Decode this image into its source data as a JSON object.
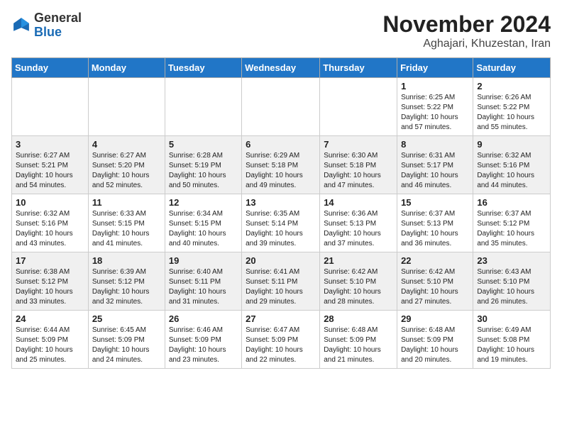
{
  "header": {
    "logo_general": "General",
    "logo_blue": "Blue",
    "title": "November 2024",
    "subtitle": "Aghajari, Khuzestan, Iran"
  },
  "calendar": {
    "days_of_week": [
      "Sunday",
      "Monday",
      "Tuesday",
      "Wednesday",
      "Thursday",
      "Friday",
      "Saturday"
    ],
    "weeks": [
      [
        {
          "day": "",
          "info": ""
        },
        {
          "day": "",
          "info": ""
        },
        {
          "day": "",
          "info": ""
        },
        {
          "day": "",
          "info": ""
        },
        {
          "day": "",
          "info": ""
        },
        {
          "day": "1",
          "info": "Sunrise: 6:25 AM\nSunset: 5:22 PM\nDaylight: 10 hours\nand 57 minutes."
        },
        {
          "day": "2",
          "info": "Sunrise: 6:26 AM\nSunset: 5:22 PM\nDaylight: 10 hours\nand 55 minutes."
        }
      ],
      [
        {
          "day": "3",
          "info": "Sunrise: 6:27 AM\nSunset: 5:21 PM\nDaylight: 10 hours\nand 54 minutes."
        },
        {
          "day": "4",
          "info": "Sunrise: 6:27 AM\nSunset: 5:20 PM\nDaylight: 10 hours\nand 52 minutes."
        },
        {
          "day": "5",
          "info": "Sunrise: 6:28 AM\nSunset: 5:19 PM\nDaylight: 10 hours\nand 50 minutes."
        },
        {
          "day": "6",
          "info": "Sunrise: 6:29 AM\nSunset: 5:18 PM\nDaylight: 10 hours\nand 49 minutes."
        },
        {
          "day": "7",
          "info": "Sunrise: 6:30 AM\nSunset: 5:18 PM\nDaylight: 10 hours\nand 47 minutes."
        },
        {
          "day": "8",
          "info": "Sunrise: 6:31 AM\nSunset: 5:17 PM\nDaylight: 10 hours\nand 46 minutes."
        },
        {
          "day": "9",
          "info": "Sunrise: 6:32 AM\nSunset: 5:16 PM\nDaylight: 10 hours\nand 44 minutes."
        }
      ],
      [
        {
          "day": "10",
          "info": "Sunrise: 6:32 AM\nSunset: 5:16 PM\nDaylight: 10 hours\nand 43 minutes."
        },
        {
          "day": "11",
          "info": "Sunrise: 6:33 AM\nSunset: 5:15 PM\nDaylight: 10 hours\nand 41 minutes."
        },
        {
          "day": "12",
          "info": "Sunrise: 6:34 AM\nSunset: 5:15 PM\nDaylight: 10 hours\nand 40 minutes."
        },
        {
          "day": "13",
          "info": "Sunrise: 6:35 AM\nSunset: 5:14 PM\nDaylight: 10 hours\nand 39 minutes."
        },
        {
          "day": "14",
          "info": "Sunrise: 6:36 AM\nSunset: 5:13 PM\nDaylight: 10 hours\nand 37 minutes."
        },
        {
          "day": "15",
          "info": "Sunrise: 6:37 AM\nSunset: 5:13 PM\nDaylight: 10 hours\nand 36 minutes."
        },
        {
          "day": "16",
          "info": "Sunrise: 6:37 AM\nSunset: 5:12 PM\nDaylight: 10 hours\nand 35 minutes."
        }
      ],
      [
        {
          "day": "17",
          "info": "Sunrise: 6:38 AM\nSunset: 5:12 PM\nDaylight: 10 hours\nand 33 minutes."
        },
        {
          "day": "18",
          "info": "Sunrise: 6:39 AM\nSunset: 5:12 PM\nDaylight: 10 hours\nand 32 minutes."
        },
        {
          "day": "19",
          "info": "Sunrise: 6:40 AM\nSunset: 5:11 PM\nDaylight: 10 hours\nand 31 minutes."
        },
        {
          "day": "20",
          "info": "Sunrise: 6:41 AM\nSunset: 5:11 PM\nDaylight: 10 hours\nand 29 minutes."
        },
        {
          "day": "21",
          "info": "Sunrise: 6:42 AM\nSunset: 5:10 PM\nDaylight: 10 hours\nand 28 minutes."
        },
        {
          "day": "22",
          "info": "Sunrise: 6:42 AM\nSunset: 5:10 PM\nDaylight: 10 hours\nand 27 minutes."
        },
        {
          "day": "23",
          "info": "Sunrise: 6:43 AM\nSunset: 5:10 PM\nDaylight: 10 hours\nand 26 minutes."
        }
      ],
      [
        {
          "day": "24",
          "info": "Sunrise: 6:44 AM\nSunset: 5:09 PM\nDaylight: 10 hours\nand 25 minutes."
        },
        {
          "day": "25",
          "info": "Sunrise: 6:45 AM\nSunset: 5:09 PM\nDaylight: 10 hours\nand 24 minutes."
        },
        {
          "day": "26",
          "info": "Sunrise: 6:46 AM\nSunset: 5:09 PM\nDaylight: 10 hours\nand 23 minutes."
        },
        {
          "day": "27",
          "info": "Sunrise: 6:47 AM\nSunset: 5:09 PM\nDaylight: 10 hours\nand 22 minutes."
        },
        {
          "day": "28",
          "info": "Sunrise: 6:48 AM\nSunset: 5:09 PM\nDaylight: 10 hours\nand 21 minutes."
        },
        {
          "day": "29",
          "info": "Sunrise: 6:48 AM\nSunset: 5:09 PM\nDaylight: 10 hours\nand 20 minutes."
        },
        {
          "day": "30",
          "info": "Sunrise: 6:49 AM\nSunset: 5:08 PM\nDaylight: 10 hours\nand 19 minutes."
        }
      ]
    ]
  }
}
